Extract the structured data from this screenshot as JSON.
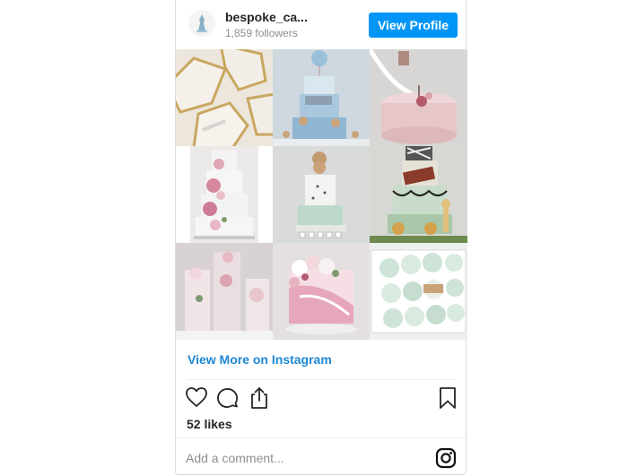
{
  "profile": {
    "username": "bespoke_ca...",
    "followers": "1,859 followers",
    "view_profile_label": "View Profile",
    "avatar_icon": "cake-logo-icon"
  },
  "posts": [
    {
      "subject": "geode cookies"
    },
    {
      "subject": "baby blue cake"
    },
    {
      "subject": "pink cake with swing"
    },
    {
      "subject": "floral tiered cake"
    },
    {
      "subject": "mint bear cake"
    },
    {
      "subject": "jungle cake"
    },
    {
      "subject": "pink floral tiers"
    },
    {
      "subject": "pink marble cake"
    },
    {
      "subject": "mint cupcakes"
    }
  ],
  "footer": {
    "view_more_label": "View More on Instagram",
    "likes_text": "52 likes",
    "comment_placeholder": "Add a comment..."
  },
  "colors": {
    "accent": "#0095f6",
    "link": "#1e88d6"
  }
}
